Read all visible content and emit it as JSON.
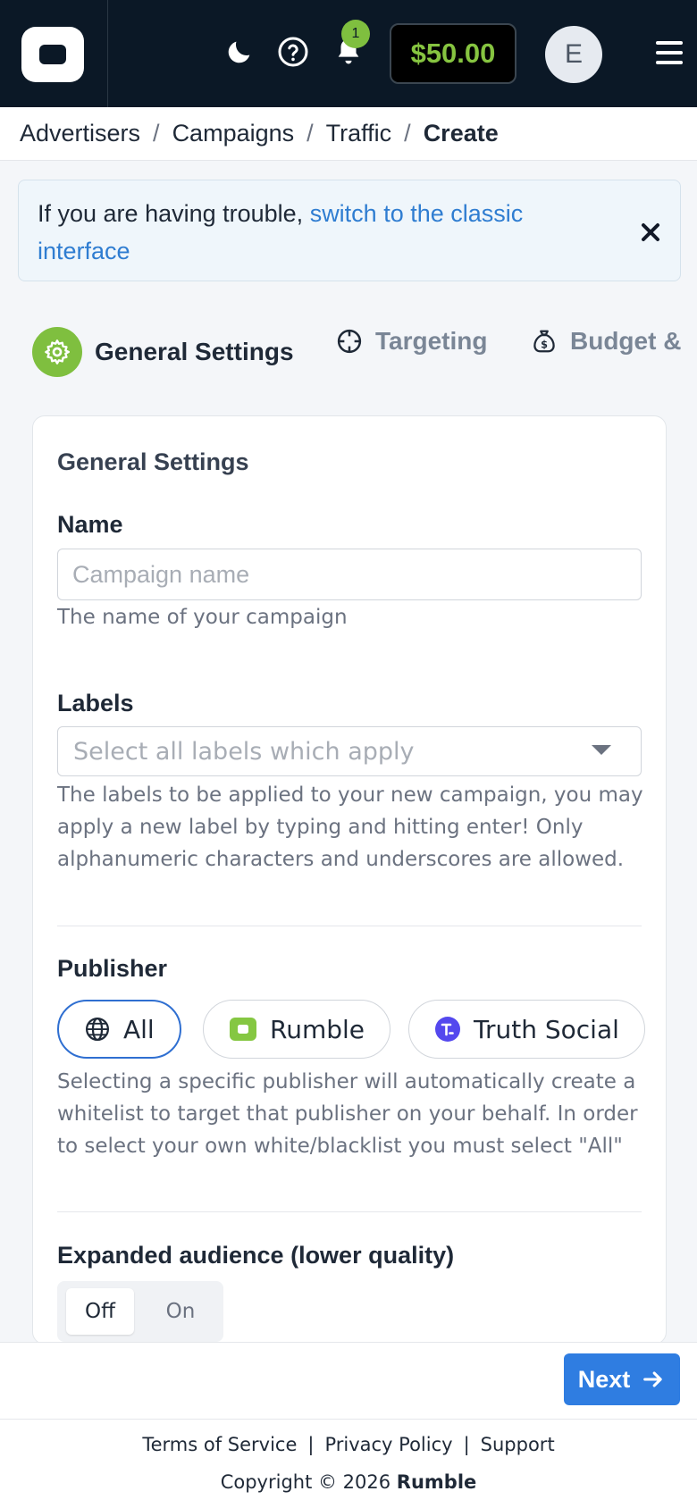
{
  "header": {
    "notification_count": "1",
    "balance": "$50.00",
    "avatar_initial": "E"
  },
  "breadcrumb": {
    "items": [
      "Advertisers",
      "Campaigns",
      "Traffic"
    ],
    "current": "Create",
    "separator": "/"
  },
  "alert": {
    "text": "If you are having trouble, ",
    "link_text": "switch to the classic interface"
  },
  "steps": {
    "general": "General Settings",
    "targeting": "Targeting",
    "budget": "Budget &"
  },
  "form": {
    "card_title": "General Settings",
    "name_label": "Name",
    "name_placeholder": "Campaign name",
    "name_value": "",
    "name_help": "The name of your campaign",
    "labels_label": "Labels",
    "labels_placeholder": "Select all labels which apply",
    "labels_help": "The labels to be applied to your new campaign, you may apply a new label by typing and hitting enter! Only alphanumeric characters and underscores are allowed.",
    "publisher_label": "Publisher",
    "publishers": [
      "All",
      "Rumble",
      "Truth Social"
    ],
    "publisher_selected": "All",
    "publisher_help": "Selecting a specific publisher will automatically create a whitelist to target that publisher on your behalf. In order to select your own white/blacklist you must select \"All\"",
    "expanded_label": "Expanded audience (lower quality)",
    "expanded_options": [
      "Off",
      "On"
    ],
    "expanded_selected": "Off"
  },
  "actions": {
    "next_label": "Next"
  },
  "footer": {
    "terms": "Terms of Service",
    "privacy": "Privacy Policy",
    "support": "Support",
    "separator": "|",
    "copyright_prefix": "Copyright © 2026 ",
    "copyright_brand": "Rumble"
  },
  "colors": {
    "topbar_bg": "#0b1826",
    "accent_green": "#7fbf3f",
    "link_blue": "#2f7dd1",
    "primary_blue": "#2f7de1"
  },
  "icons": {
    "theme": "moon-icon",
    "help": "help-circle-icon",
    "notifications": "bell-icon",
    "menu": "hamburger-icon",
    "close": "close-icon",
    "step_general": "gear-icon",
    "step_targeting": "crosshair-icon",
    "step_budget": "money-bag-icon",
    "publisher_all": "globe-icon",
    "next": "arrow-right-icon"
  }
}
